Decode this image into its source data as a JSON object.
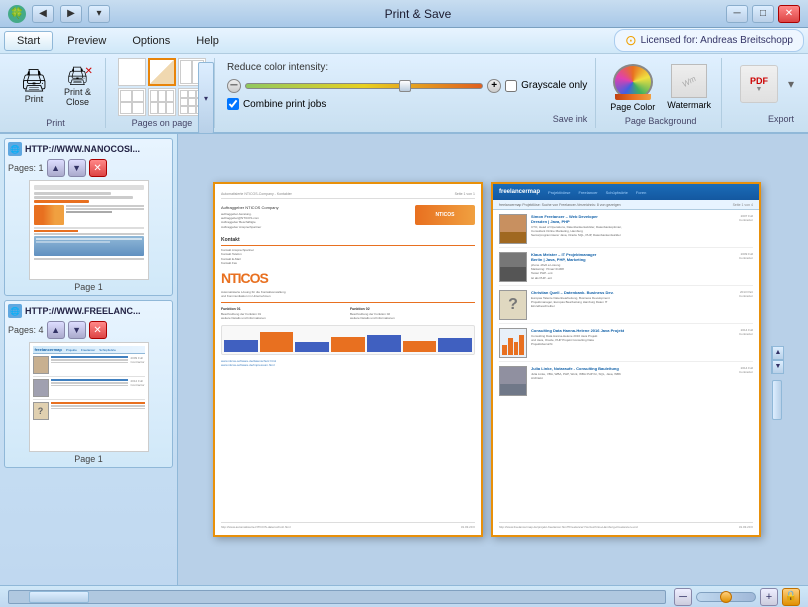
{
  "app": {
    "title": "Print & Save",
    "title_icon": "🍀"
  },
  "titlebar": {
    "buttons": {
      "back": "◀",
      "forward": "▶",
      "quick_access": "▾",
      "minimize": "─",
      "maximize": "□",
      "close": "✕"
    }
  },
  "menubar": {
    "tabs": [
      "Start",
      "Preview",
      "Options",
      "Help"
    ],
    "active_tab": "Start",
    "license_text": "Licensed for: Andreas Breitschopp"
  },
  "toolbar": {
    "print_label": "Print",
    "print_close_label": "Print &\nClose",
    "group_print_label": "Print",
    "pages_on_page_label": "Pages on page",
    "reduce_color_label": "Reduce color intensity:",
    "grayscale_label": "Grayscale only",
    "combine_label": "Combine print jobs",
    "save_ink_label": "Save ink",
    "page_color_label": "Page Color",
    "watermark_label": "Watermark",
    "page_background_label": "Page Background",
    "export_label": "Export",
    "pdf_label": "PDF"
  },
  "left_panel": {
    "items": [
      {
        "url": "HTTP://WWW.NANOCOSI...",
        "pages": "Pages: 1",
        "page_label": "Page 1"
      },
      {
        "url": "HTTP://WWW.FREELANC...",
        "pages": "Pages: 4",
        "page_label": "Page 1"
      }
    ]
  },
  "preview": {
    "left_page": {
      "header_text_left": "Automatisierte NTICOS-Company - Kontakter",
      "header_text_right": "Seite 1 von 1"
    },
    "right_page": {
      "header_text_left": "freelancermap Projektlöse: Suche von Freelancer-Verzeichnis: 8 von gezeigen",
      "header_text_right": "Seite 1 von 4"
    }
  },
  "bottombar": {
    "zoom_minus": "─",
    "zoom_plus": "+"
  },
  "icons": {
    "print": "🖨",
    "nav_up": "▲",
    "nav_down": "▼",
    "delete": "✕",
    "arrow_down": "▾",
    "arrow_up": "▴",
    "lock": "🔒"
  }
}
